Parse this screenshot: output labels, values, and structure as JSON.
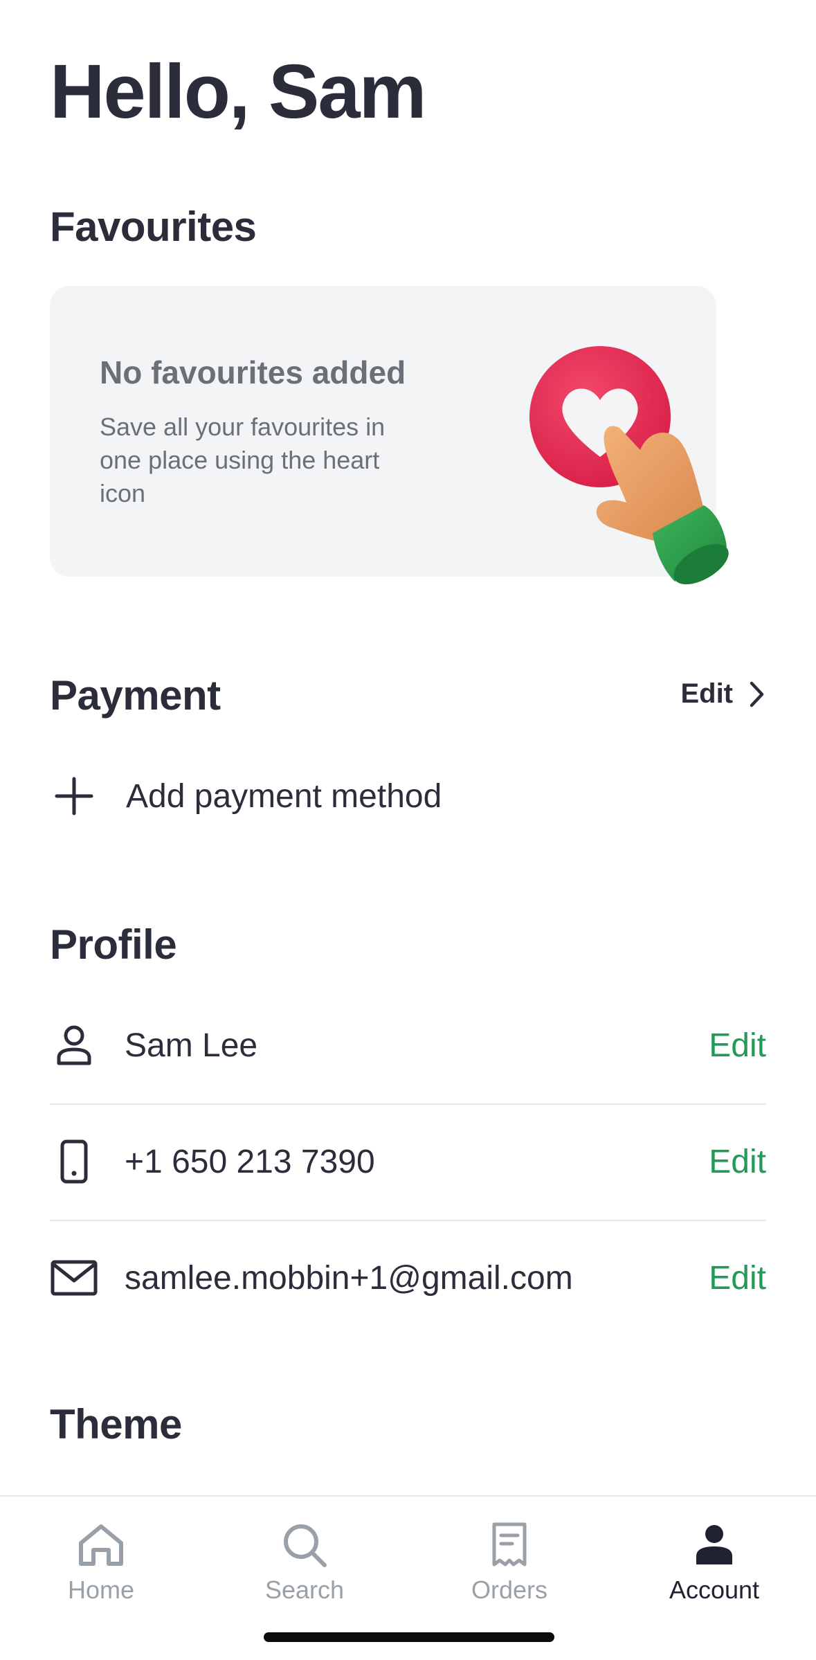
{
  "greeting": "Hello, Sam",
  "favourites": {
    "section_title": "Favourites",
    "empty_title": "No favourites added",
    "empty_description": "Save all your favourites in one place using the heart icon",
    "illustration": "heart-tap-hand-illustration"
  },
  "payment": {
    "section_title": "Payment",
    "edit_label": "Edit",
    "add_label": "Add payment method",
    "add_icon": "plus-icon"
  },
  "profile": {
    "section_title": "Profile",
    "rows": [
      {
        "icon": "person-icon",
        "value": "Sam Lee",
        "edit_label": "Edit"
      },
      {
        "icon": "phone-icon",
        "value": "+1 650 213 7390",
        "edit_label": "Edit"
      },
      {
        "icon": "mail-icon",
        "value": "samlee.mobbin+1@gmail.com",
        "edit_label": "Edit"
      }
    ]
  },
  "theme": {
    "section_title": "Theme"
  },
  "bottom_nav": {
    "items": [
      {
        "label": "Home",
        "icon": "home-icon",
        "active": false
      },
      {
        "label": "Search",
        "icon": "search-icon",
        "active": false
      },
      {
        "label": "Orders",
        "icon": "receipt-icon",
        "active": false
      },
      {
        "label": "Account",
        "icon": "account-icon",
        "active": true
      }
    ]
  },
  "colors": {
    "text_primary": "#2b2d3b",
    "text_muted": "#6b6f78",
    "accent_green": "#239a58",
    "card_bg": "#f3f4f6",
    "nav_inactive": "#9aa0a8",
    "heart_red": "#e0274f"
  }
}
